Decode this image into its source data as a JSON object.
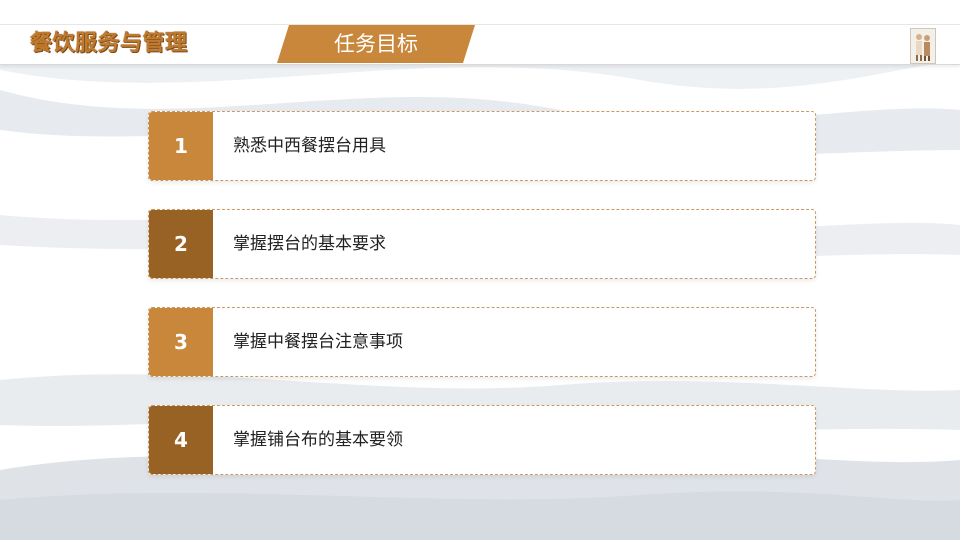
{
  "header": {
    "course_title": "餐饮服务与管理",
    "section_tab": "任务目标"
  },
  "colors": {
    "accent_light": "#c8873a",
    "accent_dark": "#976223",
    "title_text": "#c07a2d"
  },
  "objectives": [
    {
      "number": "1",
      "text": "熟悉中西餐摆台用具"
    },
    {
      "number": "2",
      "text": "掌握摆台的基本要求"
    },
    {
      "number": "3",
      "text": "掌握中餐摆台注意事项"
    },
    {
      "number": "4",
      "text": "掌握铺台布的基本要领"
    }
  ]
}
